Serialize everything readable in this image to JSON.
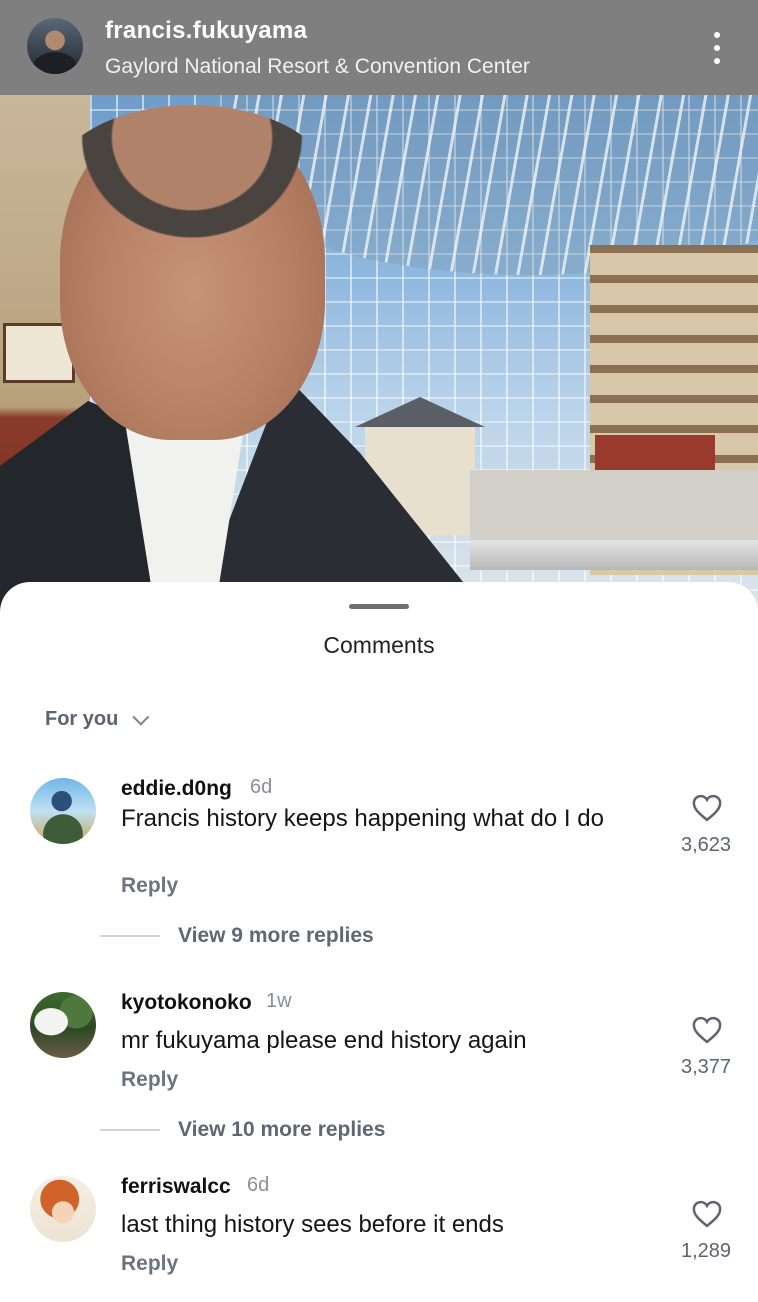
{
  "post": {
    "username": "francis.fukuyama",
    "location": "Gaylord National Resort & Convention Center"
  },
  "comments_sheet": {
    "title": "Comments",
    "filter_label": "For you",
    "reply_label": "Reply",
    "items": [
      {
        "username": "eddie.d0ng",
        "time": "6d",
        "text": "Francis history keeps happening what do I do",
        "likes": "3,623",
        "view_replies": "View 9 more replies"
      },
      {
        "username": "kyotokonoko",
        "time": "1w",
        "text": "mr fukuyama please end history again",
        "likes": "3,377",
        "view_replies": "View 10 more replies"
      },
      {
        "username": "ferriswalcc",
        "time": "6d",
        "text": "last thing history sees before it ends",
        "likes": "1,289"
      }
    ]
  },
  "icons": {
    "more": "more-vertical-icon",
    "heart": "heart-icon",
    "chevron": "chevron-down-icon"
  }
}
